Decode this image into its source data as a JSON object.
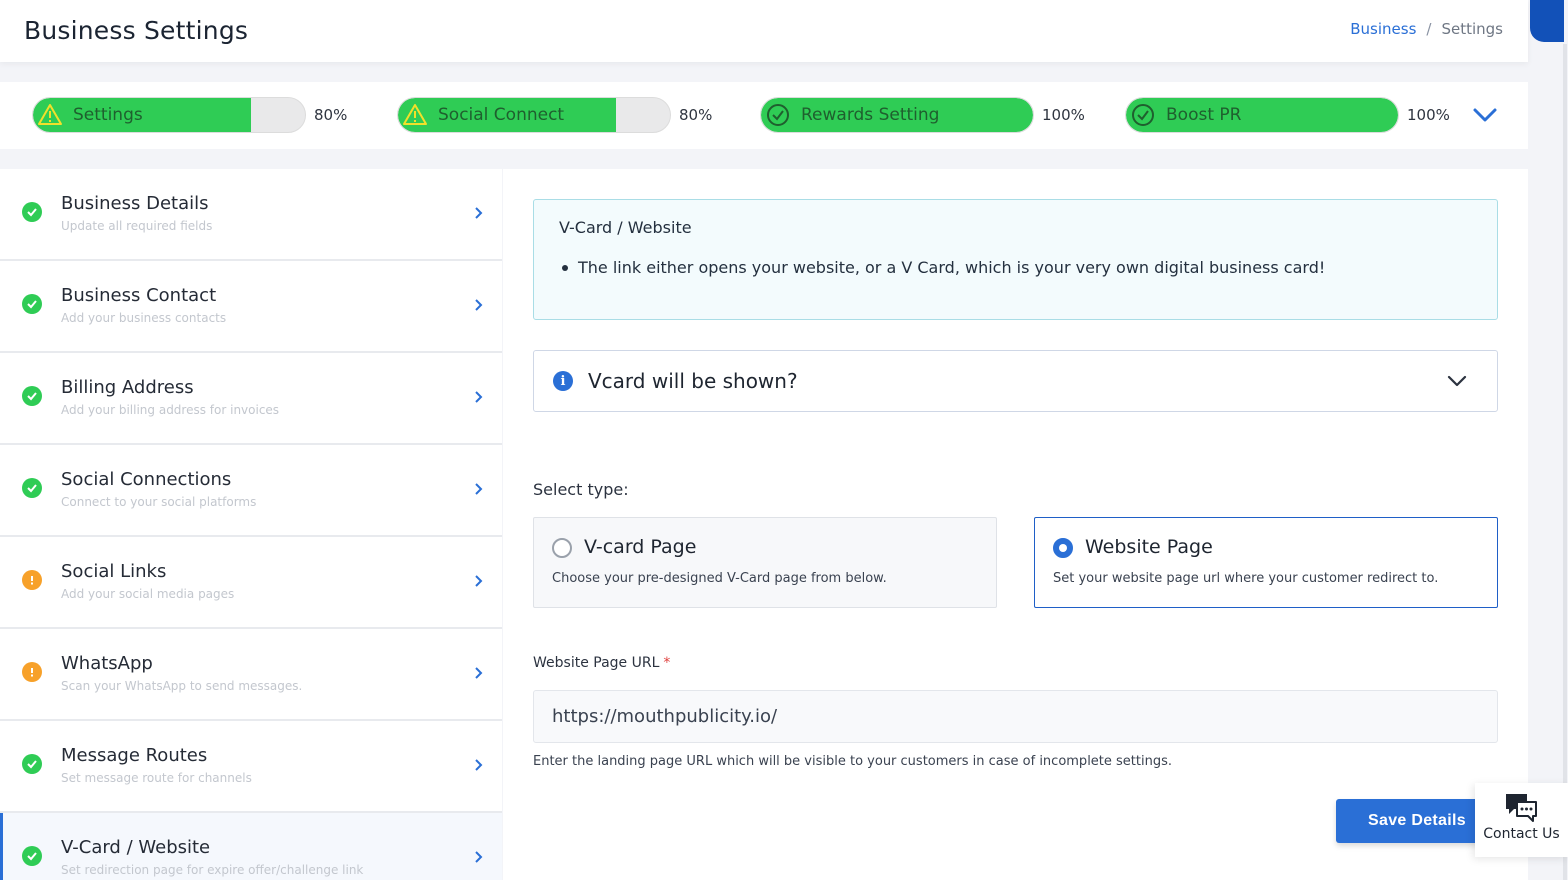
{
  "header": {
    "title": "Business Settings",
    "breadcrumb": {
      "link": "Business",
      "separator": "/",
      "current": "Settings"
    }
  },
  "progress": [
    {
      "label": "Settings",
      "percent": 80,
      "percent_text": "80%",
      "status": "warning",
      "icon": "warning-icon"
    },
    {
      "label": "Social Connect",
      "percent": 80,
      "percent_text": "80%",
      "status": "warning",
      "icon": "warning-icon"
    },
    {
      "label": "Rewards Setting",
      "percent": 100,
      "percent_text": "100%",
      "status": "complete",
      "icon": "check-circle-icon"
    },
    {
      "label": "Boost PR",
      "percent": 100,
      "percent_text": "100%",
      "status": "complete",
      "icon": "check-circle-icon"
    }
  ],
  "sidebar": {
    "items": [
      {
        "title": "Business Details",
        "subtitle": "Update all required fields",
        "status": "ok"
      },
      {
        "title": "Business Contact",
        "subtitle": "Add your business contacts",
        "status": "ok"
      },
      {
        "title": "Billing Address",
        "subtitle": "Add your billing address for invoices",
        "status": "ok"
      },
      {
        "title": "Social Connections",
        "subtitle": "Connect to your social platforms",
        "status": "ok"
      },
      {
        "title": "Social Links",
        "subtitle": "Add your social media pages",
        "status": "warn"
      },
      {
        "title": "WhatsApp",
        "subtitle": "Scan your WhatsApp to send messages.",
        "status": "warn"
      },
      {
        "title": "Message Routes",
        "subtitle": "Set message route for channels",
        "status": "ok"
      },
      {
        "title": "V-Card / Website",
        "subtitle": "Set redirection page for expire offer/challenge link",
        "status": "ok",
        "active": true
      }
    ]
  },
  "main": {
    "info": {
      "title": "V-Card / Website",
      "bullet": "The link either opens your website, or a V Card, which is your very own digital business card!"
    },
    "accordion": {
      "title": "Vcard will be shown?"
    },
    "select_label": "Select type:",
    "options": [
      {
        "title": "V-card Page",
        "description": "Choose your pre-designed V-Card page from below.",
        "selected": false
      },
      {
        "title": "Website Page",
        "description": "Set your website page url where your customer redirect to.",
        "selected": true
      }
    ],
    "url_field": {
      "label": "Website Page URL",
      "required_mark": "*",
      "value": "https://mouthpublicity.io/",
      "help": "Enter the landing page URL which will be visible to your customers in case of incomplete settings."
    },
    "save_label": "Save Details"
  },
  "contact_widget": {
    "label": "Contact Us"
  },
  "colors": {
    "accent": "#2a6fd6",
    "success": "#2fcc55",
    "warning": "#f7a12a",
    "danger": "#e0423f"
  }
}
